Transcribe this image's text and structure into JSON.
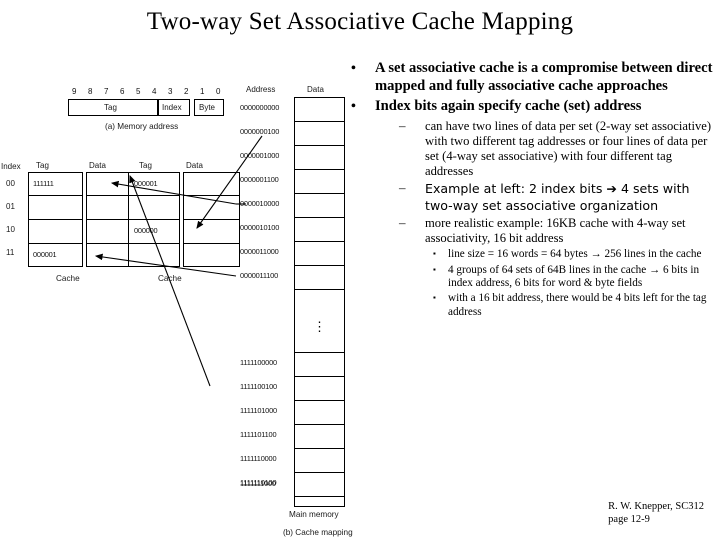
{
  "slide": {
    "title": "Two-way Set Associative Cache Mapping",
    "footer_line1": "R. W. Knepper, SC312",
    "footer_line2": "page 12-9"
  },
  "bullets": [
    {
      "level": 1,
      "marker": "•",
      "text": "A set associative cache is a compromise between direct mapped and fully associative cache approaches"
    },
    {
      "level": 1,
      "marker": "•",
      "text": "Index bits again specify cache (set) address"
    },
    {
      "level": 2,
      "marker": "–",
      "text": "can have two lines of data per set (2-way set associative) with two different tag addresses or four lines of data per set (4-way set associative) with four different tag addresses"
    },
    {
      "level": 2,
      "marker": "–",
      "text": "Example at left:  2 index bits ➔ 4 sets with two-way set associative organization"
    },
    {
      "level": 2,
      "marker": "–",
      "text": "more realistic example:  16KB cache with 4-way set associativity, 16 bit address"
    },
    {
      "level": 3,
      "marker": "▪",
      "text": "line size = 16 words = 64 bytes → 256 lines in the cache"
    },
    {
      "level": 3,
      "marker": "▪",
      "text": "4 groups of 64 sets of 64B lines in the cache → 6 bits in index address, 6 bits for word & byte fields"
    },
    {
      "level": 3,
      "marker": "▪",
      "text": "with a 16 bit address, there would be 4 bits left for the tag address"
    }
  ],
  "figure": {
    "address_format": {
      "bit_numbers": [
        "9",
        "8",
        "7",
        "6",
        "5",
        "4",
        "3",
        "2",
        "1",
        "0"
      ],
      "fields": [
        "Tag",
        "Index",
        "Byte"
      ],
      "caption": "(a) Memory address"
    },
    "cache": {
      "index_header": "Index",
      "tag_header": "Tag",
      "data_header": "Data",
      "caption_left": "Cache",
      "caption_right": "Cache",
      "index_values": [
        "00",
        "01",
        "10",
        "11"
      ],
      "way0_tags": [
        "111111",
        "",
        "",
        "000001"
      ],
      "way1_tags": [
        "000001",
        "",
        "000000",
        ""
      ]
    },
    "memory": {
      "address_header": "Address",
      "data_header": "Data",
      "caption": "Main memory",
      "addresses_top": [
        "0000000000",
        "0000000100",
        "0000001000",
        "0000001100",
        "0000010000",
        "0000010100",
        "0000011000",
        "0000011100"
      ],
      "ellipsis": "⋮",
      "addresses_bottom": [
        "1111100000",
        "1111100100",
        "1111101000",
        "1111101100",
        "1111110000",
        "1111110100",
        "1111111000",
        "1111111100"
      ]
    },
    "caption": "(b) Cache mapping"
  }
}
